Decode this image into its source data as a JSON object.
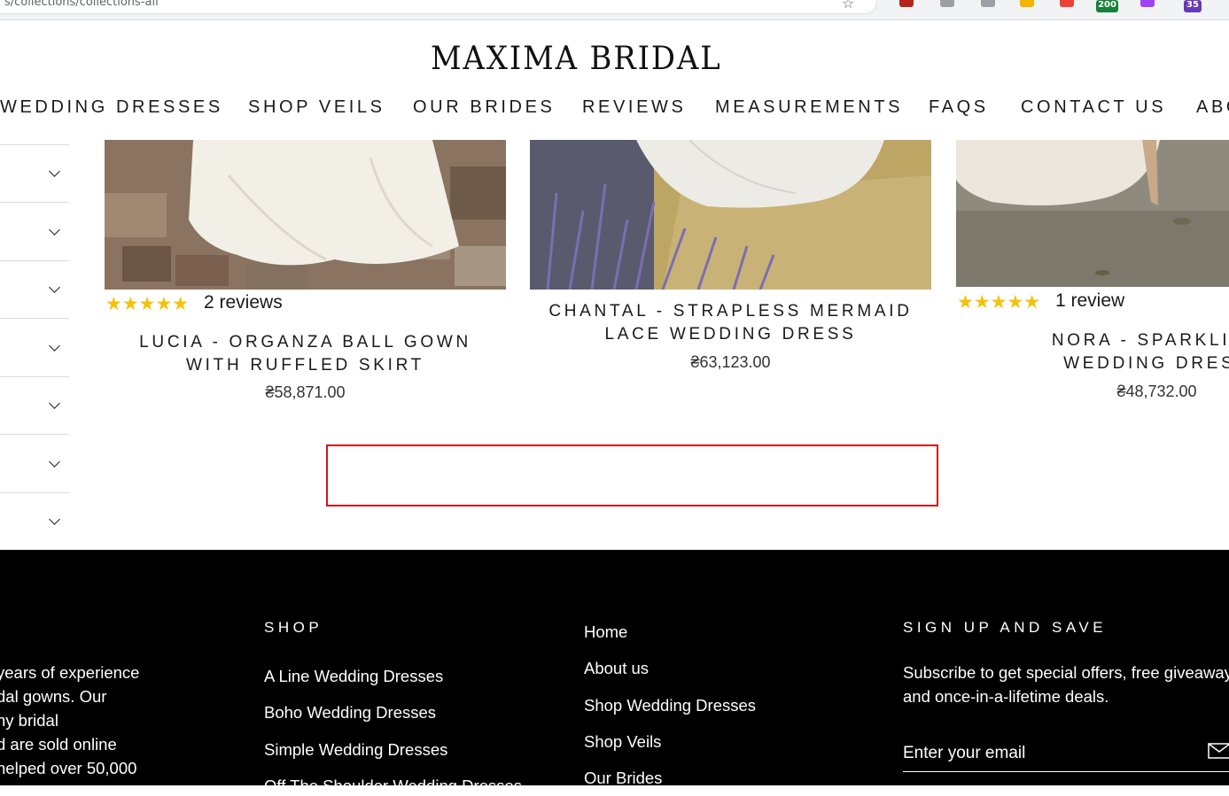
{
  "browser": {
    "url": "s/collections/collections-all",
    "extension_badges": [
      "200",
      "35"
    ]
  },
  "brand": {
    "logo": "MAXIMA BRIDAL"
  },
  "nav": {
    "items": [
      "WEDDING DRESSES",
      "SHOP VEILS",
      "OUR BRIDES",
      "REVIEWS",
      "MEASUREMENTS",
      "FAQS",
      "CONTACT US",
      "ABOUT"
    ]
  },
  "filters": {
    "count": 7
  },
  "products": [
    {
      "title": "LUCIA - ORGANZA BALL GOWN\nWITH RUFFLED SKIRT",
      "price": "₴58,871.00",
      "rating": 5,
      "stars": "★★★★★",
      "reviews": "2 reviews"
    },
    {
      "title": "CHANTAL - STRAPLESS MERMAID\nLACE WEDDING DRESS",
      "price": "₴63,123.00"
    },
    {
      "title": "NORA - SPARKLING\nWEDDING DRESS",
      "price": "₴48,732.00",
      "rating": 5,
      "stars": "★★★★★",
      "reviews": "1 review"
    }
  ],
  "footer": {
    "about_text": "years of experience\ndal gowns. Our\nny bridal\nd are sold online\n helped over 50,000",
    "shop_heading": "SHOP",
    "shop_links": [
      "A Line Wedding Dresses",
      "Boho Wedding Dresses",
      "Simple Wedding Dresses",
      "Off The Shoulder Wedding Dresses"
    ],
    "site_links": [
      "Home",
      "About us",
      "Shop Wedding Dresses",
      "Shop Veils",
      "Our Brides"
    ],
    "signup_heading": "SIGN UP AND SAVE",
    "signup_text": "Subscribe to get special offers, free giveaways, and once-in-a-lifetime deals.",
    "email_placeholder": "Enter your email"
  },
  "colors": {
    "star": "#f5c10b",
    "highlight_border": "#d0141f",
    "footer_bg": "#000000"
  }
}
